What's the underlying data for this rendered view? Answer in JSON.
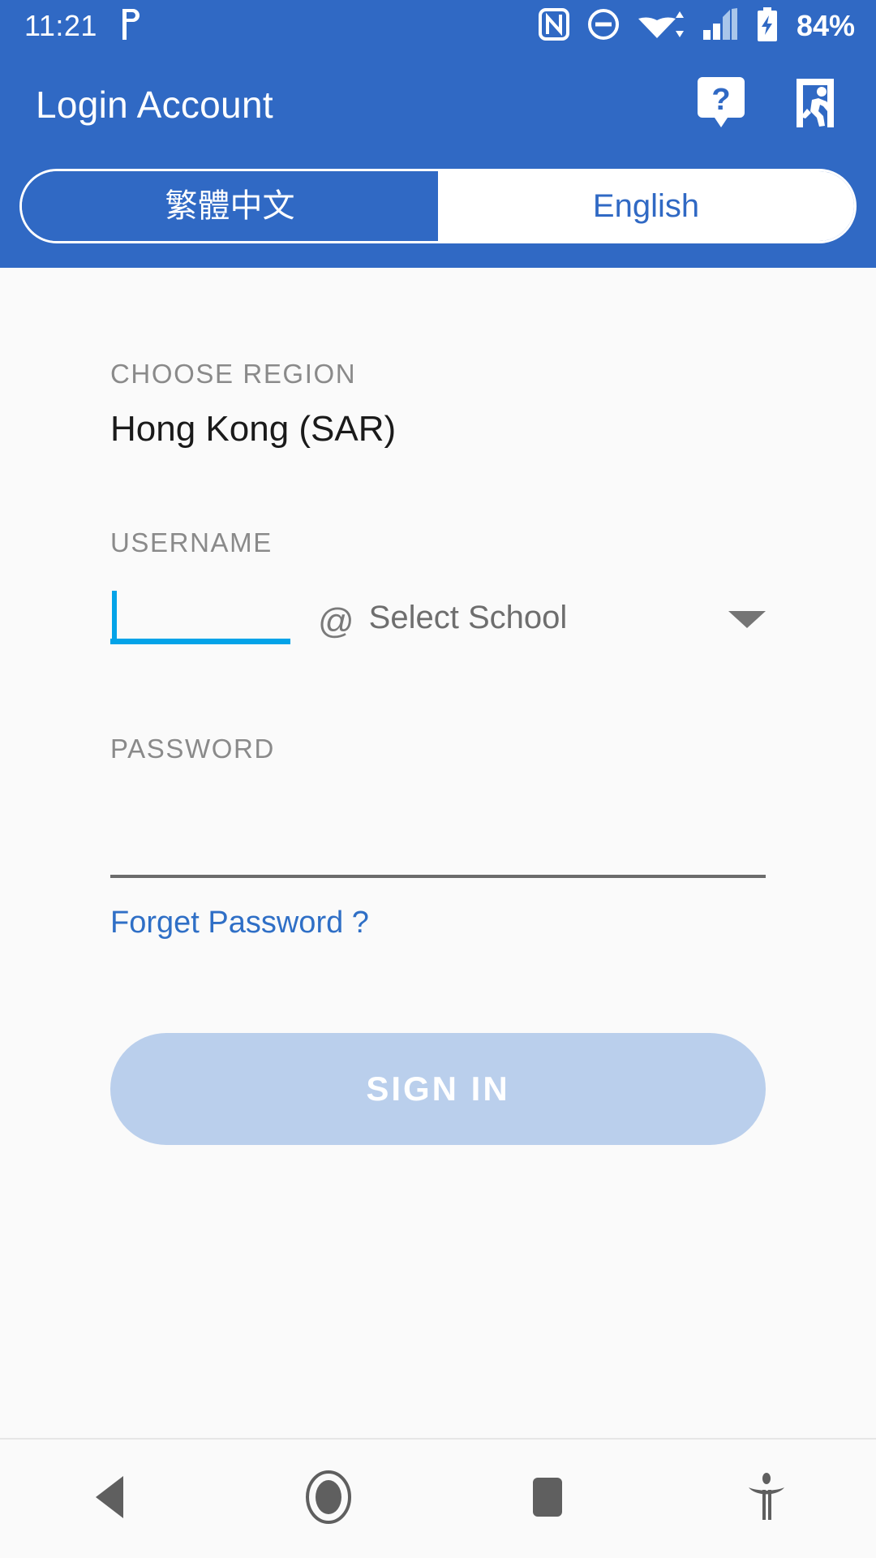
{
  "status_bar": {
    "time": "11:21",
    "battery_percent": "84%",
    "icons": [
      "power-saver-icon",
      "nfc-icon",
      "do-not-disturb-icon",
      "wifi-icon",
      "cellular-signal-icon",
      "battery-charging-icon"
    ]
  },
  "app_bar": {
    "title": "Login Account",
    "help_icon": "help-tooltip-icon",
    "exit_icon": "exit-door-icon"
  },
  "language_toggle": {
    "options": [
      {
        "label": "繁體中文",
        "selected": false
      },
      {
        "label": "English",
        "selected": true
      }
    ],
    "selected_value": "English"
  },
  "form": {
    "region": {
      "label": "CHOOSE REGION",
      "value": "Hong Kong (SAR)"
    },
    "username": {
      "label": "USERNAME",
      "value": "",
      "placeholder": "",
      "at_symbol": "@",
      "school_value": "Select School",
      "dropdown_icon": "chevron-down-icon",
      "focused": true
    },
    "password": {
      "label": "PASSWORD",
      "value": "",
      "placeholder": ""
    },
    "forget_password_label": "Forget Password ?",
    "sign_in_label": "SIGN IN"
  },
  "nav_bar": {
    "buttons": [
      {
        "name": "back-icon"
      },
      {
        "name": "home-icon"
      },
      {
        "name": "recents-icon"
      },
      {
        "name": "accessibility-icon"
      }
    ]
  },
  "colors": {
    "primary_blue": "#3069c4",
    "accent_cyan": "#03a3e8",
    "link_blue": "#2f6fc6",
    "disabled_button": "#bacfec",
    "page_background": "#fafafa"
  }
}
